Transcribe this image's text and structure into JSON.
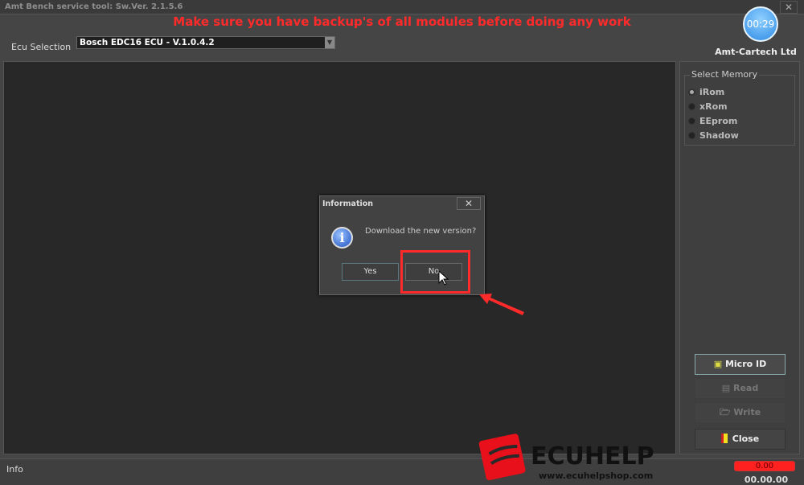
{
  "window": {
    "title": "Amt Bench service tool:  Sw.Ver. 2.1.5.6",
    "close": "✕"
  },
  "header": {
    "warning": "Make sure you have backup's of all modules before doing any work",
    "ecu_label": "Ecu Selection",
    "ecu_value": "Bosch EDC16 ECU - V.1.0.4.2",
    "timer": "00:29",
    "company": "Amt-Cartech Ltd"
  },
  "memory": {
    "title": "Select Memory",
    "selected": "iRom",
    "options": [
      "iRom",
      "xRom",
      "EEprom",
      "Shadow"
    ]
  },
  "buttons": {
    "micro_id": "Micro ID",
    "read": "Read",
    "write": "Write",
    "close": "Close"
  },
  "info": {
    "label": "Info",
    "progress": "0.00",
    "time": "00.00.00"
  },
  "dialog": {
    "title": "Information",
    "close": "✕",
    "message": "Download the new version?",
    "yes": "Yes",
    "no": "No"
  },
  "watermark": {
    "brand": "ECUHELP",
    "url": "www.ecuhelpshop.com"
  },
  "colors": {
    "warning": "#ff2a2a",
    "highlight": "#ff2a2a"
  }
}
